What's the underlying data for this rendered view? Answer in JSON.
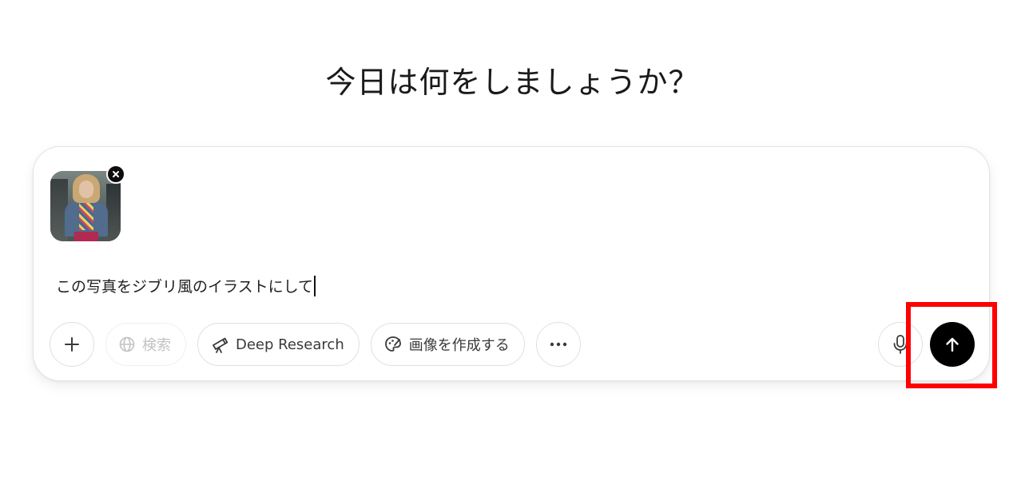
{
  "headline": "今日は何をしましょうか？",
  "composer": {
    "attachment": {
      "remove_icon": "close-icon"
    },
    "prompt_text": "この写真をジブリ風のイラストにして",
    "toolbar": {
      "add_icon": "plus-icon",
      "search_label": "検索",
      "search_icon": "globe-icon",
      "deep_research_label": "Deep Research",
      "deep_research_icon": "telescope-icon",
      "create_image_label": "画像を作成する",
      "create_image_icon": "palette-icon",
      "more_icon": "more-dots-icon",
      "mic_icon": "mic-icon",
      "send_icon": "arrow-up-icon"
    }
  },
  "colors": {
    "send_button": "#000000",
    "highlight": "#ff0000",
    "border": "#e0e0e0"
  }
}
